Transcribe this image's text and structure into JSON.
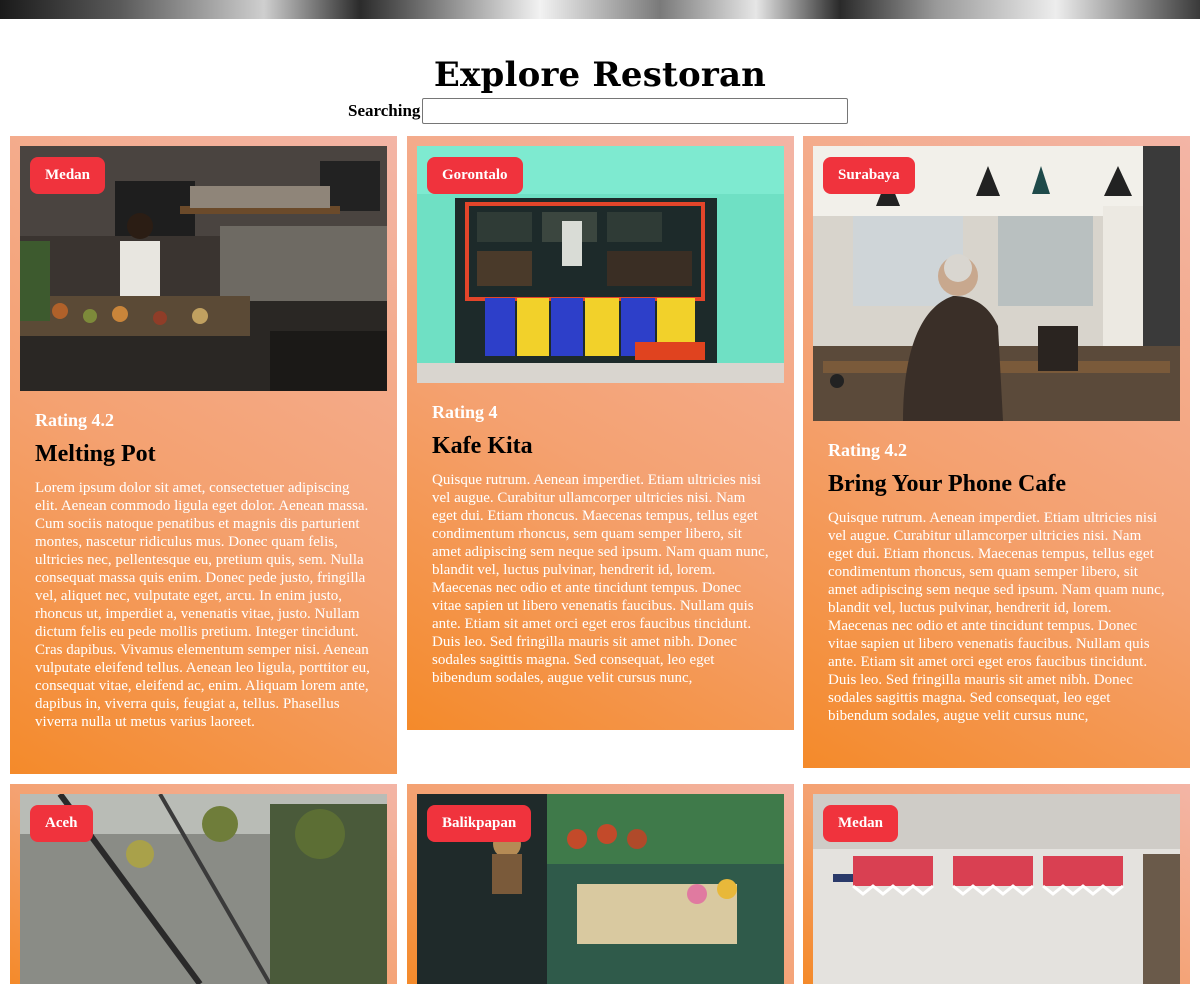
{
  "header": {
    "title": "Explore Restoran"
  },
  "search": {
    "label": "Searching",
    "value": "",
    "placeholder": ""
  },
  "restaurants": [
    {
      "city": "Medan",
      "rating": "Rating 4.2",
      "name": "Melting Pot",
      "image": "restaurant counter photo",
      "description": "Lorem ipsum dolor sit amet, consectetuer adipiscing elit. Aenean commodo ligula eget dolor. Aenean massa. Cum sociis natoque penatibus et magnis dis parturient montes, nascetur ridiculus mus. Donec quam felis, ultricies nec, pellentesque eu, pretium quis, sem. Nulla consequat massa quis enim. Donec pede justo, fringilla vel, aliquet nec, vulputate eget, arcu. In enim justo, rhoncus ut, imperdiet a, venenatis vitae, justo. Nullam dictum felis eu pede mollis pretium. Integer tincidunt. Cras dapibus. Vivamus elementum semper nisi. Aenean vulputate eleifend tellus. Aenean leo ligula, porttitor eu, consequat vitae, eleifend ac, enim. Aliquam lorem ante, dapibus in, viverra quis, feugiat a, tellus. Phasellus viverra nulla ut metus varius laoreet."
    },
    {
      "city": "Gorontalo",
      "rating": "Rating 4",
      "name": "Kafe Kita",
      "image": "colorful storefront photo",
      "description": "Quisque rutrum. Aenean imperdiet. Etiam ultricies nisi vel augue. Curabitur ullamcorper ultricies nisi. Nam eget dui. Etiam rhoncus. Maecenas tempus, tellus eget condimentum rhoncus, sem quam semper libero, sit amet adipiscing sem neque sed ipsum. Nam quam nunc, blandit vel, luctus pulvinar, hendrerit id, lorem. Maecenas nec odio et ante tincidunt tempus. Donec vitae sapien ut libero venenatis faucibus. Nullam quis ante. Etiam sit amet orci eget eros faucibus tincidunt. Duis leo. Sed fringilla mauris sit amet nibh. Donec sodales sagittis magna. Sed consequat, leo eget bibendum sodales, augue velit cursus nunc,"
    },
    {
      "city": "Surabaya",
      "rating": "Rating 4.2",
      "name": "Bring Your Phone Cafe",
      "image": "cafe interior photo",
      "description": "Quisque rutrum. Aenean imperdiet. Etiam ultricies nisi vel augue. Curabitur ullamcorper ultricies nisi. Nam eget dui. Etiam rhoncus. Maecenas tempus, tellus eget condimentum rhoncus, sem quam semper libero, sit amet adipiscing sem neque sed ipsum. Nam quam nunc, blandit vel, luctus pulvinar, hendrerit id, lorem. Maecenas nec odio et ante tincidunt tempus. Donec vitae sapien ut libero venenatis faucibus. Nullam quis ante. Etiam sit amet orci eget eros faucibus tincidunt. Duis leo. Sed fringilla mauris sit amet nibh. Donec sodales sagittis magna. Sed consequat, leo eget bibendum sodales, augue velit cursus nunc,"
    },
    {
      "city": "Aceh",
      "image": "greenhouse cafe photo"
    },
    {
      "city": "Balikpapan",
      "image": "plant shop photo"
    },
    {
      "city": "Medan",
      "image": "striped awning storefront photo"
    }
  ],
  "colors": {
    "badge": "#f0333d",
    "card_gradient_start": "#f48a2a",
    "card_gradient_end": "#f3b5a6"
  }
}
